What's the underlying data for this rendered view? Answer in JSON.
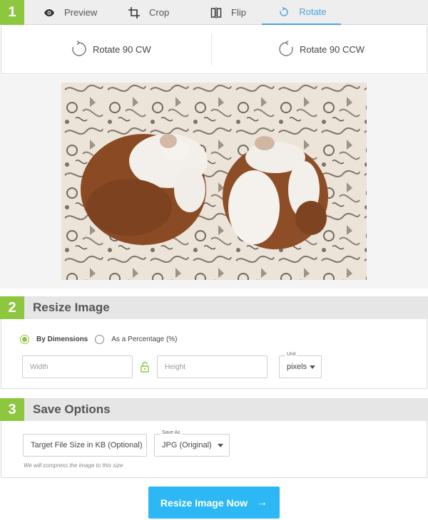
{
  "steps": {
    "one": "1",
    "two": "2",
    "three": "3"
  },
  "tabs": {
    "preview": "Preview",
    "crop": "Crop",
    "flip": "Flip",
    "rotate": "Rotate",
    "active": "rotate"
  },
  "rotate": {
    "cw": "Rotate 90 CW",
    "ccw": "Rotate 90 CCW"
  },
  "resize": {
    "title": "Resize Image",
    "by_dimensions": "By Dimensions",
    "as_percentage": "As a Percentage (%)",
    "selected_mode": "by_dimensions",
    "width_placeholder": "Width",
    "height_placeholder": "Height",
    "unit_label": "Unit",
    "unit_value": "pixels"
  },
  "save": {
    "title": "Save Options",
    "target_size": "Target File Size in KB (Optional)",
    "save_as_label": "Save As",
    "save_as_value": "JPG (Original)",
    "hint": "We will compress the image to this size"
  },
  "cta": {
    "label": "Resize Image Now",
    "arrow": "→"
  },
  "colors": {
    "accent_green": "#8dc63f",
    "accent_blue": "#2db7f5",
    "tab_active": "#4aa3df"
  }
}
